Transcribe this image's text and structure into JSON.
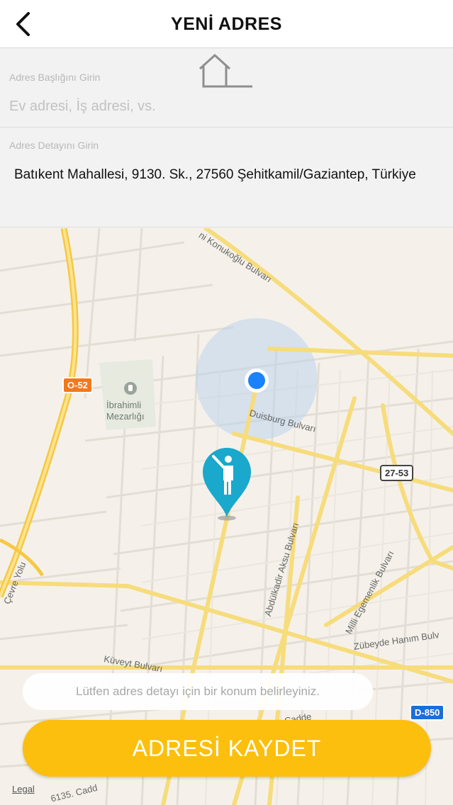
{
  "header": {
    "title": "YENİ ADRES",
    "back_icon": "chevron-left-icon"
  },
  "form": {
    "title_label": "Adres Başlığını Girin",
    "title_placeholder": "Ev adresi, İş adresi, vs.",
    "detail_label": "Adres Detayını Girin",
    "detail_value": "Batıkent Mahallesi, 9130. Sk., 27560 Şehitkamil/Gaziantep, Türkiye",
    "icon": "home-icon"
  },
  "map": {
    "labels": {
      "konukoglu": "ni Konukoğlu Bulvarı",
      "duisburg": "Duisburg Bulvarı",
      "ibrahimli_1": "İbrahimli",
      "ibrahimli_2": "Mezarlığı",
      "abdulkadir": "Abdülkadir Aksu Bulvarı",
      "egemenlik": "Milli Egemenlik Bulvarı",
      "zubeyde": "Zübeyde Hanım Bulv",
      "cevre": "Çevre Yolu",
      "kuveyt": "Küveyt Bulvarı",
      "cadde_1": "Cadde",
      "cadde_2": "6135. Cadd"
    },
    "routes": {
      "o52": "O-52",
      "r2753": "27-53",
      "d850": "D-850"
    },
    "markers": {
      "current_location": "current-location-dot",
      "picked_location": "person-pin-icon"
    }
  },
  "hint": "Lütfen adres detayı için bir konum belirleyiniz.",
  "save_button": "ADRESİ KAYDET",
  "legal": "Legal",
  "colors": {
    "accent": "#fcbf0d",
    "pin": "#1aa8cc",
    "location_dot": "#1a82fb"
  }
}
